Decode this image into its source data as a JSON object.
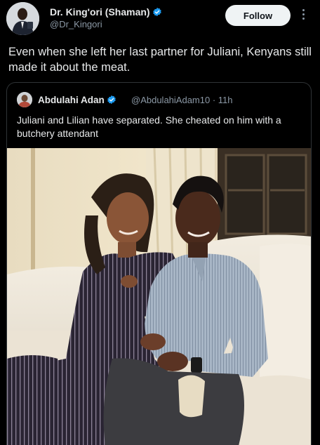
{
  "author": {
    "name": "Dr. King'ori (Shaman)",
    "handle": "@Dr_Kingori",
    "follow_label": "Follow"
  },
  "tweet": {
    "text": "Even when she left her last partner for Juliani, Kenyans still made it about the meat."
  },
  "quoted": {
    "name": "Abdulahi Adan",
    "handle": "@AbdulahiAdam10",
    "time": "11h",
    "text": "Juliani and Lilian have separated. She cheated on him with a butchery attendant"
  },
  "colors": {
    "background": "#000000",
    "verified": "#1d9bf0",
    "secondary_text": "#8b98a5",
    "follow_button": "#eff3f4"
  },
  "icons": [
    "verified-badge-icon",
    "more-options-icon"
  ]
}
